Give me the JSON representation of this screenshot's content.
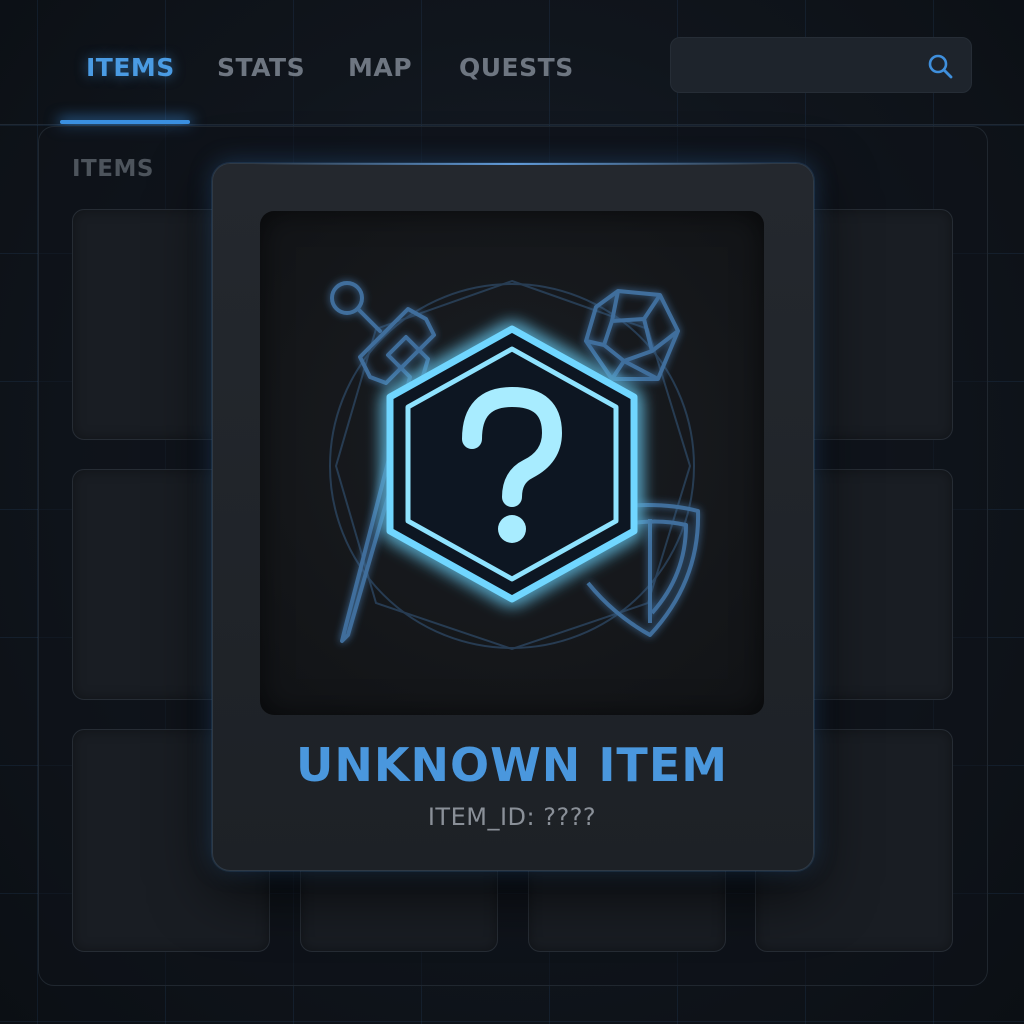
{
  "nav": {
    "tabs": [
      {
        "label": "ITEMS",
        "active": true
      },
      {
        "label": "STATS",
        "active": false
      },
      {
        "label": "MAP",
        "active": false
      },
      {
        "label": "QUESTS",
        "active": false
      }
    ],
    "search": {
      "value": "",
      "placeholder": "",
      "icon": "search-icon"
    }
  },
  "inventory": {
    "title": "ITEMS",
    "slots_icon": "empty-slot"
  },
  "item_modal": {
    "name": "UNKNOWN ITEM",
    "id_text": "ITEM_ID: ????",
    "icons": [
      "sword-icon",
      "gem-icon",
      "shield-icon",
      "question-mark-hexagon-icon"
    ]
  },
  "colors": {
    "accent": "#4a9be3",
    "glow": "#5fd0ff",
    "background": "#0d1117",
    "panel": "#1d2126"
  }
}
